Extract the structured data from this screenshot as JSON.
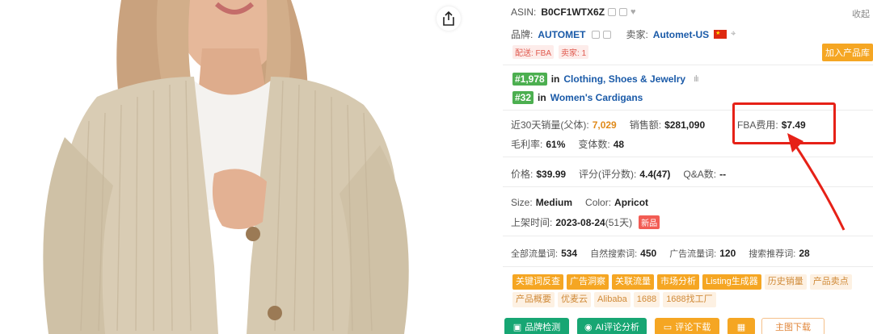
{
  "product": {
    "image_alt": "Woman wearing beige oversized V-neck button cardigan over white top"
  },
  "share": {
    "icon": "share-icon"
  },
  "panel": {
    "asin_label": "ASIN:",
    "asin_value": "B0CF1WTX6Z",
    "collapse": "收起",
    "brand_label": "品牌:",
    "brand_value": "AUTOMET",
    "seller_label": "卖家:",
    "seller_value": "Automet-US",
    "ship_tag": "配送: FBA",
    "sellers_tag": "卖家: 1",
    "add_product": "加入产品库",
    "rank1_num": "#1,978",
    "rank1_in": "in",
    "rank1_cat": "Clothing, Shoes & Jewelry",
    "rank2_num": "#32",
    "rank2_in": "in",
    "rank2_cat": "Women's Cardigans",
    "sales30_label": "近30天销量(父体):",
    "sales30_value": "7,029",
    "revenue_label": "销售额:",
    "revenue_value": "$281,090",
    "fba_label": "FBA费用:",
    "fba_value": "$7.49",
    "margin_label": "毛利率:",
    "margin_value": "61%",
    "variants_label": "变体数:",
    "variants_value": "48",
    "price_label": "价格:",
    "price_value": "$39.99",
    "rating_label": "评分(评分数):",
    "rating_value": "4.4(47)",
    "qa_label": "Q&A数:",
    "qa_value": "--",
    "size_label": "Size:",
    "size_value": "Medium",
    "color_label": "Color:",
    "color_value": "Apricot",
    "listed_label": "上架时间:",
    "listed_date": "2023-08-24",
    "listed_days": "(51天)",
    "new_tag": "新品",
    "kw_all_label": "全部流量词:",
    "kw_all_value": "534",
    "kw_natural_label": "自然搜索词:",
    "kw_natural_value": "450",
    "kw_ad_label": "广告流量词:",
    "kw_ad_value": "120",
    "kw_rec_label": "搜索推荐词:",
    "kw_rec_value": "28"
  },
  "chips_row1": [
    {
      "label": "关键词反查",
      "active": true
    },
    {
      "label": "广告洞察",
      "active": true
    },
    {
      "label": "关联流量",
      "active": true
    },
    {
      "label": "市场分析",
      "active": true
    },
    {
      "label": "Listing生成器",
      "active": true
    },
    {
      "label": "历史销量",
      "active": false
    },
    {
      "label": "产品卖点",
      "active": false
    }
  ],
  "chips_row2": [
    {
      "label": "产品概要",
      "active": false
    },
    {
      "label": "优麦云",
      "active": false
    },
    {
      "label": "Alibaba",
      "active": false
    },
    {
      "label": "1688",
      "active": false
    },
    {
      "label": "1688找工厂",
      "active": false
    }
  ],
  "buttons": {
    "brand_check": "品牌检测",
    "ai_review": "AI评论分析",
    "review_download": "评论下载",
    "homepage_download": "主图下载"
  },
  "colors": {
    "accent_orange": "#f5a623",
    "rank_green": "#4caf50",
    "button_green": "#17a673",
    "annotation_red": "#e62117",
    "link_blue": "#1a5aa8"
  }
}
